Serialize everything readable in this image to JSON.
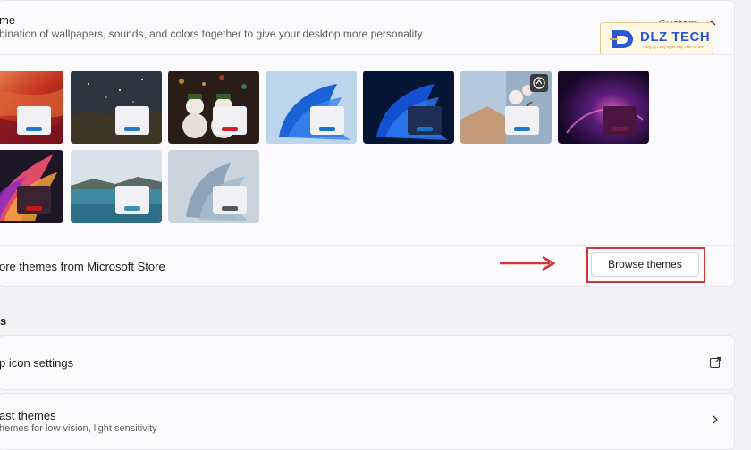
{
  "theme": {
    "title": "me",
    "description": "bination of wallpapers, sounds, and colors together to give your desktop more personality",
    "current": "Custom"
  },
  "themes": [
    {
      "name": "theme-red-canyon",
      "accent": "#1f7ac8"
    },
    {
      "name": "theme-night-sky",
      "accent": "#1f7ac8"
    },
    {
      "name": "theme-snowmen",
      "accent": "#d61f26"
    },
    {
      "name": "theme-windows-bloom-light",
      "accent": "#1a73c9"
    },
    {
      "name": "theme-windows-bloom-dark",
      "accent": "#1a73c9"
    },
    {
      "name": "theme-spring-blossom",
      "accent": "#1f7ac8"
    },
    {
      "name": "theme-purple-glow",
      "accent": "#6c1a4e"
    },
    {
      "name": "theme-ribbon-flow",
      "accent": "#c01818"
    },
    {
      "name": "theme-lake",
      "accent": "#3c8fb0"
    },
    {
      "name": "theme-captured-motion",
      "accent": "#4f5a63"
    }
  ],
  "store": {
    "label": "ore themes from Microsoft Store",
    "button": "Browse themes"
  },
  "related": {
    "heading": "s",
    "desktop_icon": "p icon settings",
    "contrast_title": "ast themes",
    "contrast_desc": "hemes for low vision, light sensitivity"
  },
  "logo": {
    "brand": "DLZ TECH",
    "tagline": "Công Ty Công Nghệ Máy Tính Số Một"
  },
  "colors": {
    "highlight": "#d3343a",
    "arrow": "#d3343a"
  }
}
